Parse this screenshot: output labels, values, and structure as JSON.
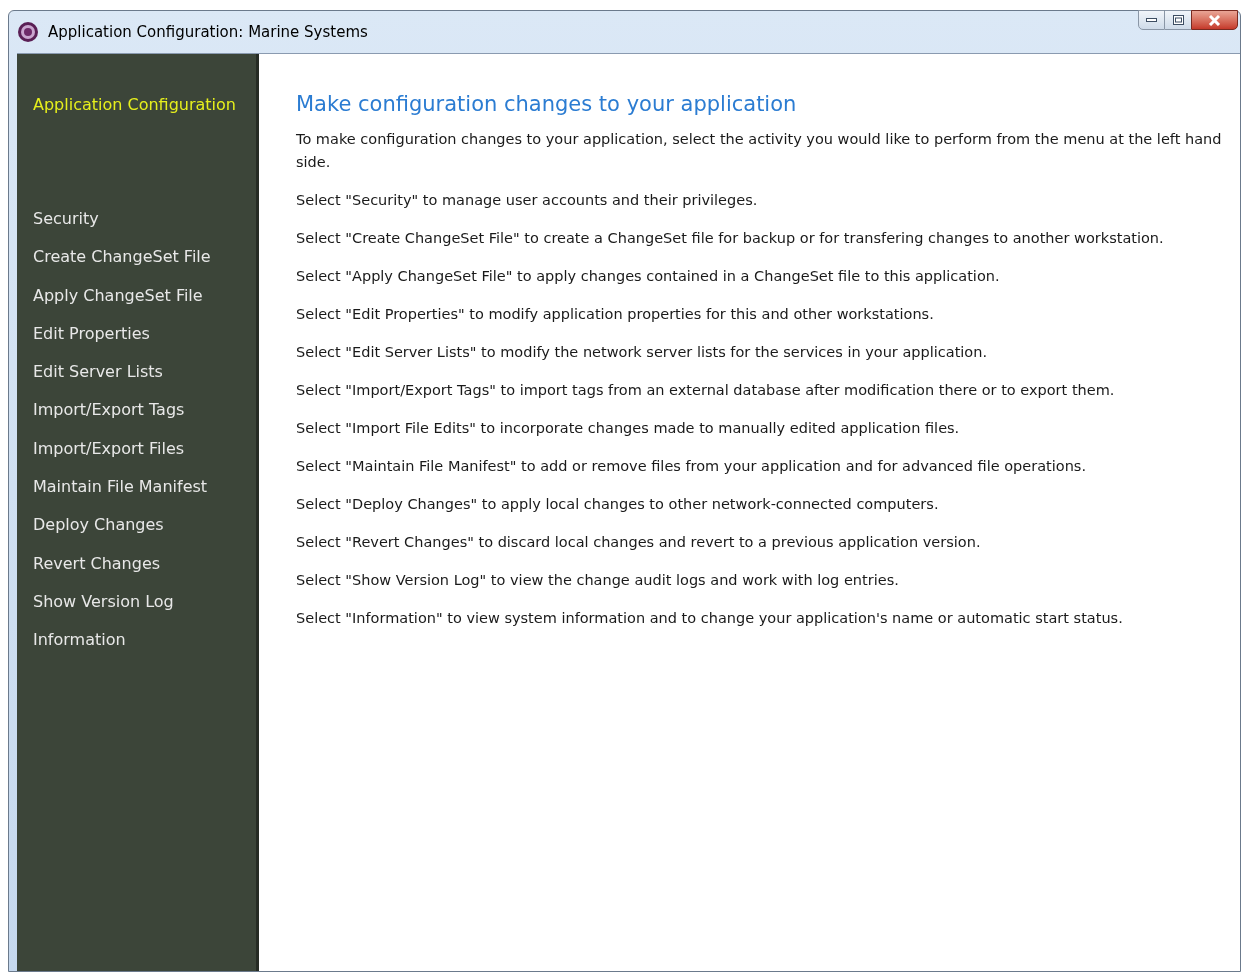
{
  "window": {
    "title": "Application Configuration: Marine Systems"
  },
  "sidebar": {
    "heading": "Application Configuration",
    "items": [
      "Security",
      "Create ChangeSet File",
      "Apply ChangeSet File",
      "Edit Properties",
      "Edit Server Lists",
      "Import/Export Tags",
      "Import/Export Files",
      "Maintain File Manifest",
      "Deploy Changes",
      "Revert Changes",
      "Show Version Log",
      "Information"
    ]
  },
  "content": {
    "heading": "Make configuration changes to your application",
    "paragraphs": [
      "To make configuration changes to your application, select the activity you would like to perform from the menu at the left hand side.",
      "Select \"Security\" to manage user accounts and their privileges.",
      "Select \"Create ChangeSet File\" to create a ChangeSet file for backup or for transfering changes to another workstation.",
      "Select \"Apply ChangeSet File\" to apply changes contained in a ChangeSet file to this application.",
      "Select \"Edit Properties\" to modify application properties for this and other workstations.",
      "Select \"Edit Server Lists\" to modify the network server lists for the services in your application.",
      "Select \"Import/Export Tags\" to import tags from an external database after modification there or to export them.",
      "Select \"Import File Edits\" to incorporate changes made to manually edited application files.",
      "Select \"Maintain File Manifest\" to add or remove files from your application and for advanced file operations.",
      "Select \"Deploy Changes\" to apply local changes to other network-connected computers.",
      "Select \"Revert Changes\" to discard local changes and revert to a previous application version.",
      "Select \"Show Version Log\" to view the change audit logs and work with log entries.",
      "Select \"Information\" to view system information and to change your application's name or automatic start status."
    ]
  }
}
